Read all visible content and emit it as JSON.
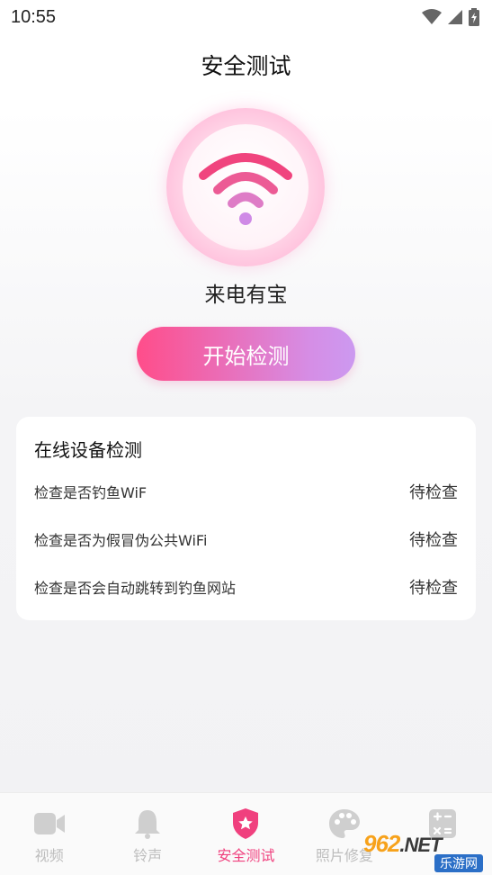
{
  "status_bar": {
    "time": "10:55"
  },
  "header": {
    "title": "安全测试"
  },
  "hero": {
    "network_name": "来电有宝"
  },
  "actions": {
    "start_label": "开始检测"
  },
  "card": {
    "title": "在线设备检测",
    "checks": [
      {
        "label": "检查是否钓鱼WiF",
        "status": "待检查"
      },
      {
        "label": "检查是否为假冒伪公共WiFi",
        "status": "待检查"
      },
      {
        "label": "检查是否会自动跳转到钓鱼网站",
        "status": "待检查"
      }
    ]
  },
  "bottom_nav": {
    "items": [
      {
        "label": "视频",
        "icon": "video-camera-icon"
      },
      {
        "label": "铃声",
        "icon": "bell-icon"
      },
      {
        "label": "安全测试",
        "icon": "shield-star-icon",
        "active": true
      },
      {
        "label": "照片修复",
        "icon": "palette-icon"
      },
      {
        "label": "",
        "icon": "calculator-icon"
      }
    ]
  },
  "watermark": {
    "brand": "962",
    "net": ".NET",
    "subtitle": "乐游网"
  },
  "colors": {
    "accent": "#f0407e",
    "gradient_start": "#ff4d8a",
    "gradient_end": "#cc99f0"
  }
}
